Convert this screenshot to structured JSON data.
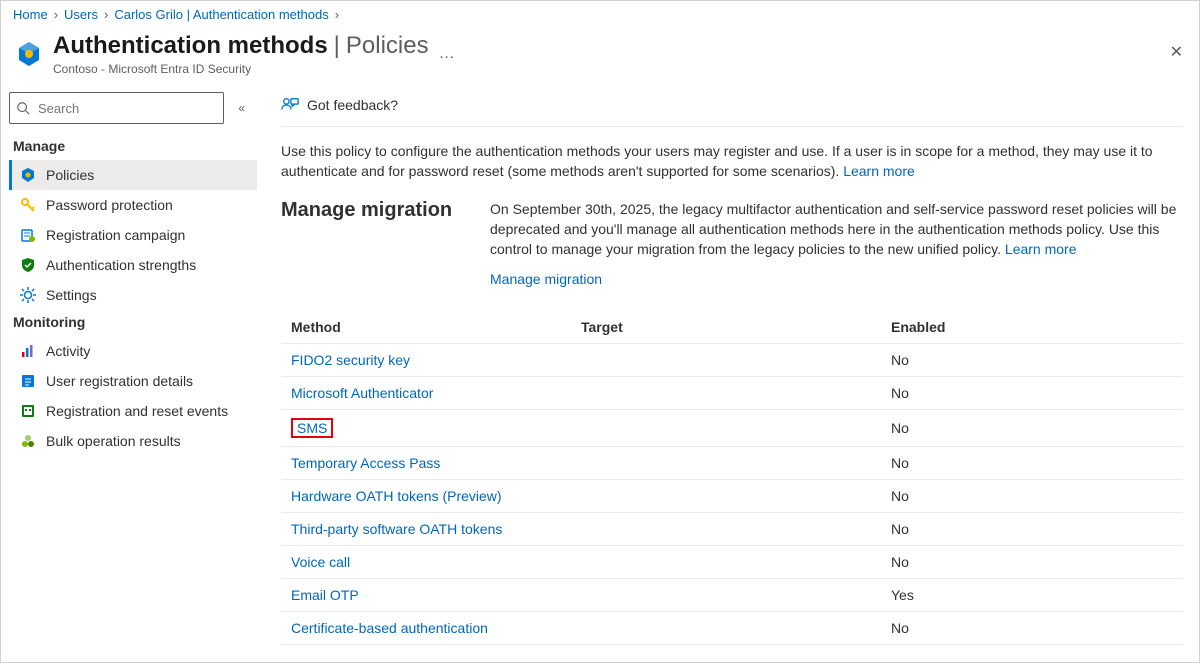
{
  "breadcrumbs": [
    "Home",
    "Users",
    "Carlos Grilo | Authentication methods"
  ],
  "header": {
    "title": "Authentication methods",
    "subtitle": "Policies",
    "org": "Contoso - Microsoft Entra ID Security"
  },
  "search": {
    "placeholder": "Search"
  },
  "sidebar": {
    "groups": [
      {
        "label": "Manage",
        "items": [
          {
            "key": "policies",
            "label": "Policies",
            "active": true,
            "iconColor": "#0078d4",
            "icon": "policies"
          },
          {
            "key": "password-protection",
            "label": "Password protection",
            "iconColor": "#ffb900",
            "icon": "key"
          },
          {
            "key": "registration-campaign",
            "label": "Registration campaign",
            "iconColor": "#0078d4",
            "icon": "campaign"
          },
          {
            "key": "auth-strengths",
            "label": "Authentication strengths",
            "iconColor": "#107c10",
            "icon": "shield"
          },
          {
            "key": "settings",
            "label": "Settings",
            "iconColor": "#0078d4",
            "icon": "gear"
          }
        ]
      },
      {
        "label": "Monitoring",
        "items": [
          {
            "key": "activity",
            "label": "Activity",
            "iconColor": "#8661c5",
            "icon": "chart"
          },
          {
            "key": "user-registration",
            "label": "User registration details",
            "iconColor": "#0078d4",
            "icon": "details"
          },
          {
            "key": "reg-reset-events",
            "label": "Registration and reset events",
            "iconColor": "#107c10",
            "icon": "events"
          },
          {
            "key": "bulk-results",
            "label": "Bulk operation results",
            "iconColor": "#7fba00",
            "icon": "bulk"
          }
        ]
      }
    ]
  },
  "toolbar": {
    "feedback": "Got feedback?"
  },
  "description": {
    "text": "Use this policy to configure the authentication methods your users may register and use. If a user is in scope for a method, they may use it to authenticate and for password reset (some methods aren't supported for some scenarios). ",
    "learn_more": "Learn more"
  },
  "migration": {
    "heading": "Manage migration",
    "body": "On September 30th, 2025, the legacy multifactor authentication and self-service password reset policies will be deprecated and you'll manage all authentication methods here in the authentication methods policy. Use this control to manage your migration from the legacy policies to the new unified policy. ",
    "learn_more": "Learn more",
    "link": "Manage migration"
  },
  "table": {
    "columns": {
      "method": "Method",
      "target": "Target",
      "enabled": "Enabled"
    },
    "rows": [
      {
        "method": "FIDO2 security key",
        "target": "",
        "enabled": "No"
      },
      {
        "method": "Microsoft Authenticator",
        "target": "",
        "enabled": "No"
      },
      {
        "method": "SMS",
        "target": "",
        "enabled": "No",
        "highlight": true
      },
      {
        "method": "Temporary Access Pass",
        "target": "",
        "enabled": "No"
      },
      {
        "method": "Hardware OATH tokens (Preview)",
        "target": "",
        "enabled": "No"
      },
      {
        "method": "Third-party software OATH tokens",
        "target": "",
        "enabled": "No"
      },
      {
        "method": "Voice call",
        "target": "",
        "enabled": "No"
      },
      {
        "method": "Email OTP",
        "target": "",
        "enabled": "Yes"
      },
      {
        "method": "Certificate-based authentication",
        "target": "",
        "enabled": "No"
      }
    ]
  }
}
